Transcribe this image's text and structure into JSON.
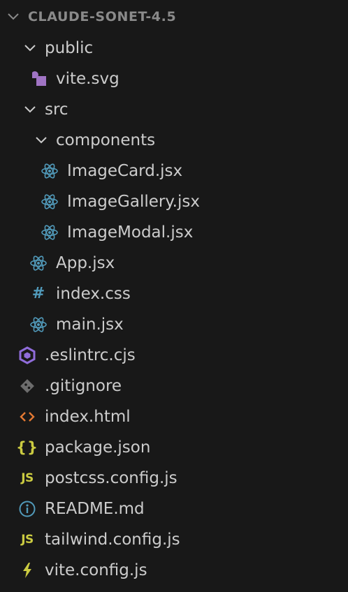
{
  "explorer": {
    "project_name": "CLAUDE-SONET-4.5",
    "items": [
      {
        "name": "public",
        "type": "folder",
        "expanded": true,
        "icon": "chevron-down-icon"
      },
      {
        "name": "vite.svg",
        "type": "file",
        "icon": "svg-file-icon"
      },
      {
        "name": "src",
        "type": "folder",
        "expanded": true,
        "icon": "chevron-down-icon"
      },
      {
        "name": "components",
        "type": "folder",
        "expanded": true,
        "icon": "chevron-down-icon"
      },
      {
        "name": "ImageCard.jsx",
        "type": "file",
        "icon": "react-icon"
      },
      {
        "name": "ImageGallery.jsx",
        "type": "file",
        "icon": "react-icon"
      },
      {
        "name": "ImageModal.jsx",
        "type": "file",
        "icon": "react-icon"
      },
      {
        "name": "App.jsx",
        "type": "file",
        "icon": "react-icon"
      },
      {
        "name": "index.css",
        "type": "file",
        "icon": "css-hash-icon"
      },
      {
        "name": "main.jsx",
        "type": "file",
        "icon": "react-icon"
      },
      {
        "name": ".eslintrc.cjs",
        "type": "file",
        "icon": "eslint-icon"
      },
      {
        "name": ".gitignore",
        "type": "file",
        "icon": "git-icon"
      },
      {
        "name": "index.html",
        "type": "file",
        "icon": "html-icon"
      },
      {
        "name": "package.json",
        "type": "file",
        "icon": "json-braces-icon"
      },
      {
        "name": "postcss.config.js",
        "type": "file",
        "icon": "js-icon"
      },
      {
        "name": "README.md",
        "type": "file",
        "icon": "info-icon"
      },
      {
        "name": "tailwind.config.js",
        "type": "file",
        "icon": "js-icon"
      },
      {
        "name": "vite.config.js",
        "type": "file",
        "icon": "lightning-icon"
      }
    ]
  },
  "glyphs": {
    "js": "JS",
    "hash": "#",
    "braces": "{}"
  },
  "colors": {
    "background": "#181818",
    "text": "#cccccc",
    "header_text": "#8a8a8a",
    "react_blue": "#519aba",
    "js_yellow": "#cbcb41",
    "eslint_purple": "#8f6cd9",
    "svg_purple": "#a074c4",
    "git_gray": "#8a8a8a",
    "html_orange": "#e37933",
    "info_blue": "#519aba"
  }
}
